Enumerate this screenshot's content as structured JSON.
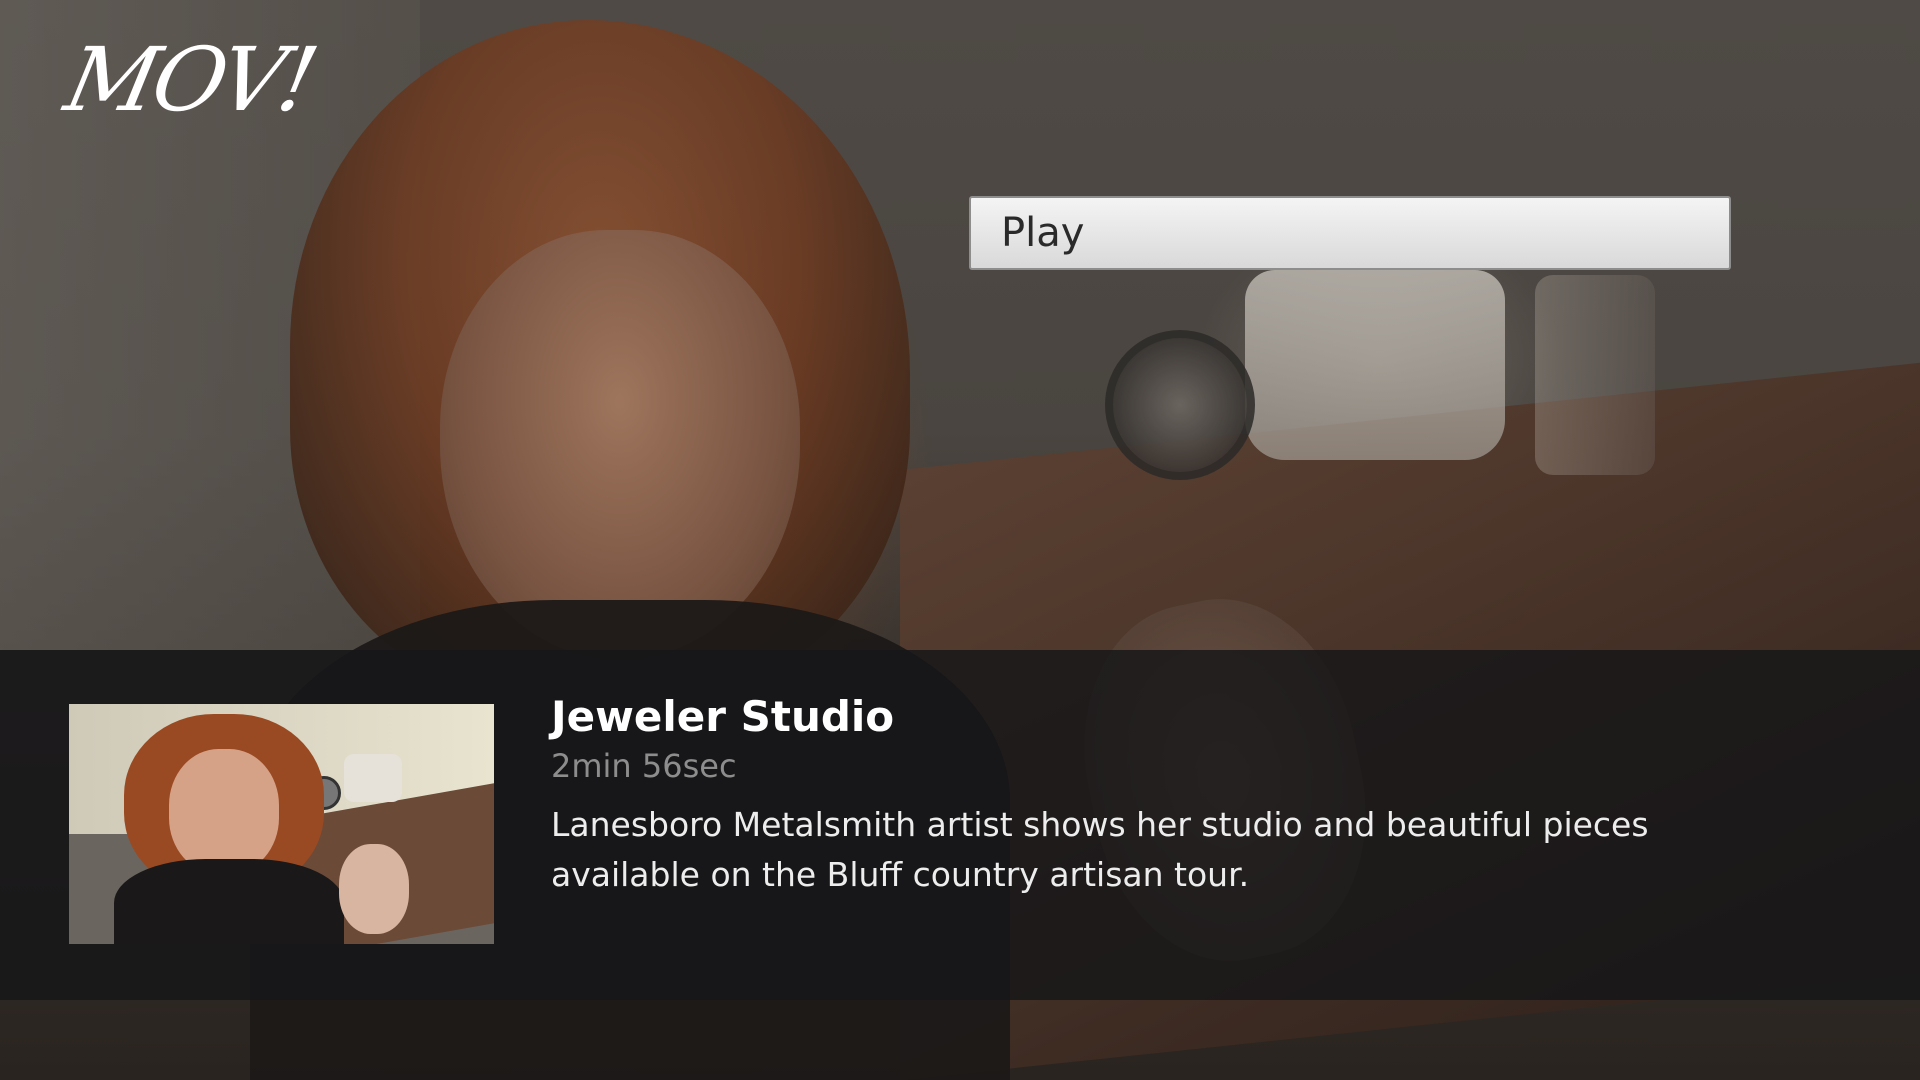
{
  "app": {
    "logo_text": "MOV!"
  },
  "actions": {
    "play_label": "Play"
  },
  "video": {
    "title": "Jeweler Studio",
    "duration": "2min 56sec",
    "description": "Lanesboro Metalsmith artist shows her studio and beautiful pieces available on the Bluff country artisan tour."
  },
  "icons": {
    "logo": "mov-logo",
    "thumbnail": "video-thumbnail"
  }
}
